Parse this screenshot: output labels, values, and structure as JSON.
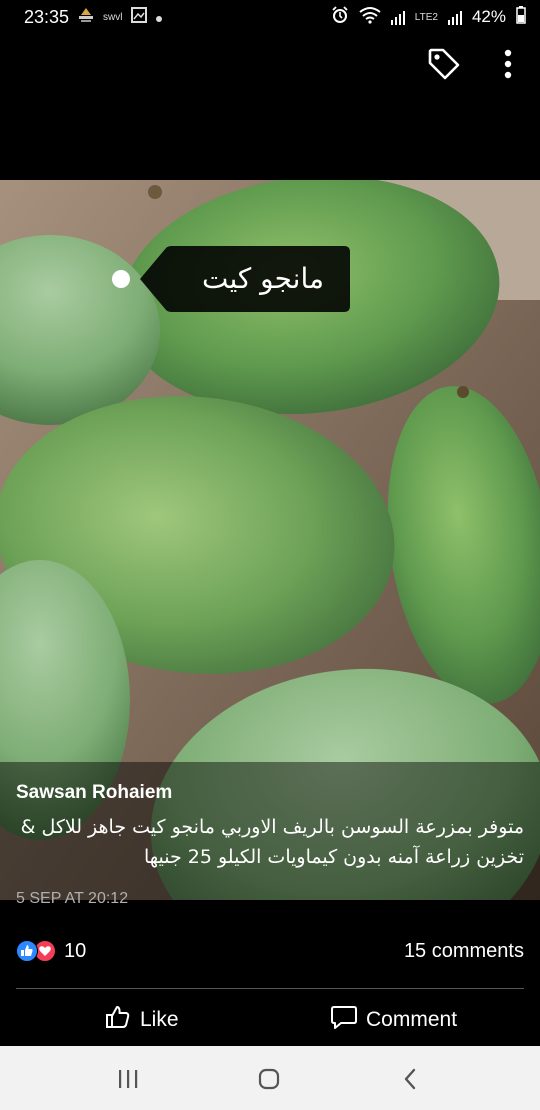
{
  "status_bar": {
    "time": "23:35",
    "carrier_label": "swvl",
    "battery_percent": "42%",
    "network_label": "LTE2"
  },
  "top_bar": {
    "tag_icon": "tag-icon",
    "more_icon": "more-vertical-icon"
  },
  "photo": {
    "tag_label": "مانجو كيت"
  },
  "post": {
    "author": "Sawsan Rohaiem",
    "text": "متوفر بمزرعة السوسن بالريف الاوربي مانجو كيت جاهز للاكل & تخزين زراعة آمنه بدون كيماويات الكيلو 25 جنيها",
    "timestamp": "5 SEP AT 20:12"
  },
  "engagement": {
    "reaction_count": "10",
    "comments_label": "15 comments",
    "reaction_icons": [
      "like-reaction-icon",
      "love-reaction-icon"
    ]
  },
  "actions": {
    "like_label": "Like",
    "comment_label": "Comment"
  },
  "nav": {
    "recents_icon": "recents-icon",
    "home_icon": "home-icon",
    "back_icon": "back-icon"
  },
  "colors": {
    "like_blue": "#2d88ff",
    "love_red": "#f33e58",
    "background": "#000000",
    "nav_bar": "#f2f2f2"
  }
}
